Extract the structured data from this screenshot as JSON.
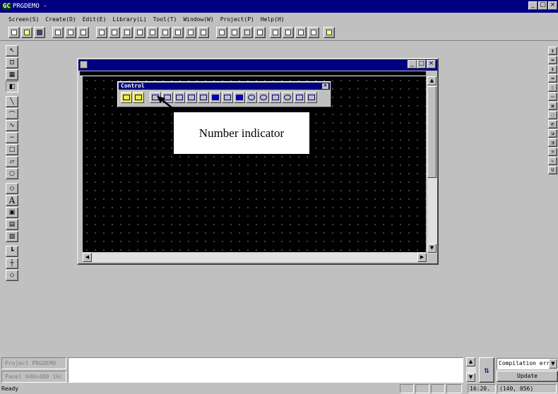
{
  "app": {
    "logo": "GC",
    "title": "PRGDEMO -"
  },
  "menu": [
    "Screen(S)",
    "Create(D)",
    "Edit(E)",
    "Library(L)",
    "Tool(T)",
    "Window(W)",
    "Project(P)",
    "Help(H)"
  ],
  "control_palette": {
    "title": "Control",
    "close": "×"
  },
  "annotation": {
    "text": "Number indicator"
  },
  "project_panel": {
    "line1": "Project PRGDEMO",
    "line2": "Panel 640x480 16c"
  },
  "compile": {
    "dropdown_value": "Compilation erro",
    "update_label": "Update"
  },
  "status": {
    "ready": "Ready",
    "time": "16:20.",
    "coords": "(140, 056)"
  },
  "icons": {
    "left": [
      "pointer-icon",
      "zoom-icon",
      "property-icon",
      "select-object-icon",
      "line-icon",
      "arc-icon",
      "polyline-icon",
      "curve-icon",
      "rectangle-icon",
      "parallelogram-icon",
      "ellipse-icon",
      "polygon-icon",
      "text-icon",
      "bitmap-icon",
      "button-icon",
      "pattern-icon",
      "scale-icon",
      "axis-icon",
      "diamond-icon"
    ],
    "right": [
      "align-left-icon",
      "align-top-icon",
      "align-right-icon",
      "align-bottom-icon",
      "center-h-icon",
      "center-v-icon",
      "group-icon",
      "ungroup-icon",
      "front-icon",
      "back-icon",
      "flip-h-icon",
      "flip-v-icon",
      "rotate-icon",
      "underline-icon"
    ]
  },
  "colors": {
    "title_bar": "#000080",
    "canvas": "#000000",
    "face": "#c0c0c0"
  }
}
